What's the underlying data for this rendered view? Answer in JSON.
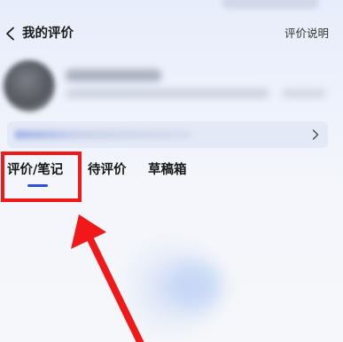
{
  "header": {
    "title": "我的评价",
    "explain_link": "评价说明"
  },
  "tabs": [
    {
      "label": "评价/笔记",
      "active": true
    },
    {
      "label": "待评价",
      "active": false
    },
    {
      "label": "草稿箱",
      "active": false
    }
  ],
  "colors": {
    "accent": "#2f4fd8",
    "annotation": "#f01818"
  },
  "icons": {
    "back": "chevron-left-icon",
    "card": "chevron-right-icon"
  }
}
